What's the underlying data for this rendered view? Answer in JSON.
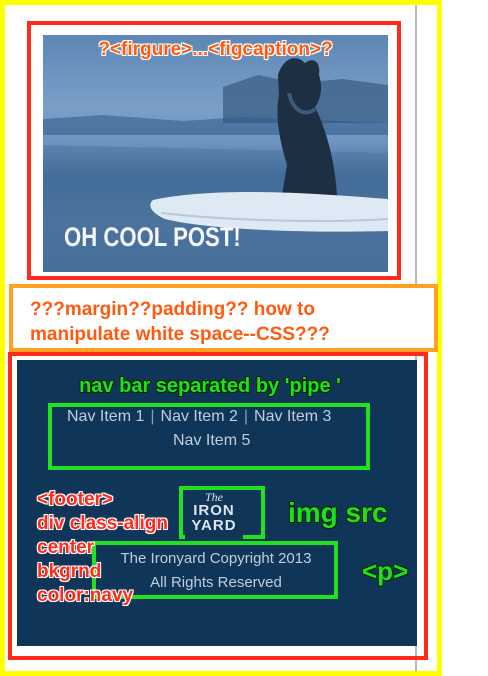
{
  "annotations": {
    "figcaption_label": "?<firgure>...<figcaption>?",
    "whitespace_note_line1": "???margin??padding?? how to",
    "whitespace_note_line2": "manipulate white space--CSS???",
    "nav_note": "nav bar separated by 'pipe '",
    "img_note": "img src",
    "p_note": "<p>",
    "footer_note": [
      "<footer>",
      "div class-align",
      "center",
      "bkgrnd",
      "color:navy"
    ]
  },
  "hero": {
    "caption": "OH COOL POST!"
  },
  "nav": {
    "items": [
      "Nav Item 1",
      "Nav Item 2",
      "Nav Item 3",
      "Nav Item 5"
    ]
  },
  "footer": {
    "logo_line1": "The",
    "logo_line2": "IRON",
    "logo_line3": "YARD",
    "copyright": "The Ironyard Copyright 2013",
    "rights": "All Rights Reserved"
  },
  "colors": {
    "footer_navy": "#0f3558",
    "annotation_red": "#ff2a1a",
    "annotation_orange": "#ffa020",
    "annotation_green": "#22e022",
    "outer_yellow": "#ffff00"
  }
}
